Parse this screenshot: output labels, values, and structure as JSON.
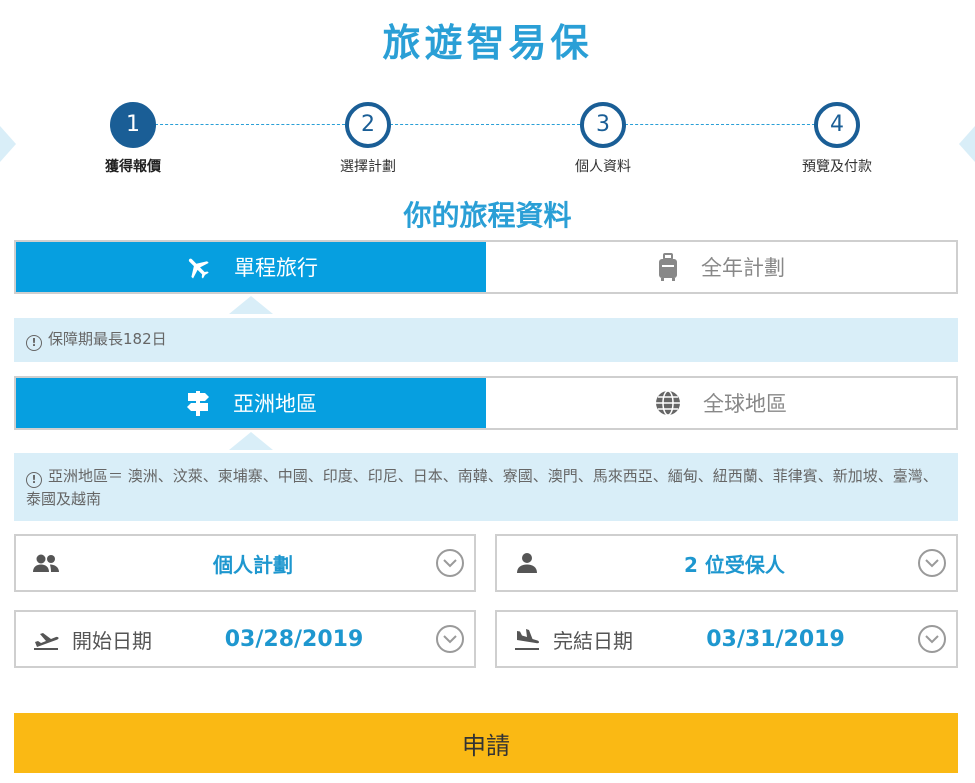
{
  "page": {
    "title": "旅遊智易保",
    "subtitle": "你的旅程資料"
  },
  "steps": [
    {
      "number": "1",
      "label": "獲得報價",
      "active": true
    },
    {
      "number": "2",
      "label": "選擇計劃",
      "active": false
    },
    {
      "number": "3",
      "label": "個人資料",
      "active": false
    },
    {
      "number": "4",
      "label": "預覽及付款",
      "active": false
    }
  ],
  "trip_type": {
    "single": "單程旅行",
    "annual": "全年計劃",
    "selected": "single",
    "note": "保障期最長182日"
  },
  "region": {
    "asia": "亞洲地區",
    "global": "全球地區",
    "selected": "asia",
    "note": "亞洲地區＝ 澳洲、汶萊、柬埔寨、中國、印度、印尼、日本、南韓、寮國、澳門、馬來西亞、緬甸、紐西蘭、菲律賓、新加坡、臺灣、泰國及越南"
  },
  "plan": {
    "value": "個人計劃",
    "icon": "group-icon"
  },
  "insured": {
    "value": "2 位受保人",
    "icon": "person-icon"
  },
  "start_date": {
    "label": "開始日期",
    "value": "03/28/2019",
    "icon": "plane-takeoff-icon"
  },
  "end_date": {
    "label": "完結日期",
    "value": "03/31/2019",
    "icon": "plane-landing-icon"
  },
  "apply_button": "申請",
  "colors": {
    "primary": "#069fe0",
    "step": "#1a5e96",
    "info_bg": "#d9eef8",
    "button": "#fab914"
  }
}
